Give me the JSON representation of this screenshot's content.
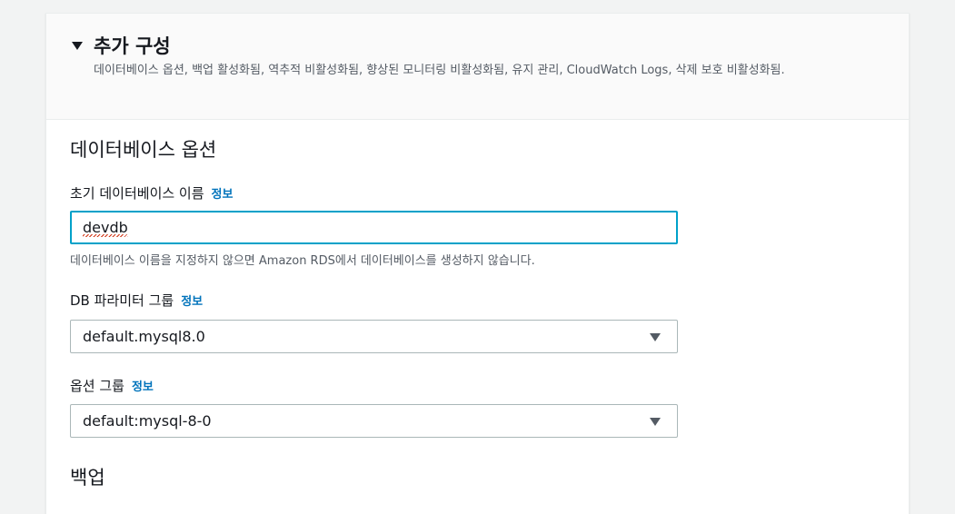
{
  "section": {
    "title": "추가 구성",
    "description": "데이터베이스 옵션, 백업 활성화됨, 역추적 비활성화됨, 향상된 모니터링 비활성화됨, 유지 관리, CloudWatch Logs, 삭제 보호 비활성화됨."
  },
  "db_options": {
    "heading": "데이터베이스 옵션",
    "initial_db_name": {
      "label": "초기 데이터베이스 이름",
      "info": "정보",
      "value": "devdb",
      "helper": "데이터베이스 이름을 지정하지 않으면 Amazon RDS에서 데이터베이스를 생성하지 않습니다."
    },
    "parameter_group": {
      "label": "DB 파라미터 그룹",
      "info": "정보",
      "value": "default.mysql8.0"
    },
    "option_group": {
      "label": "옵션 그룹",
      "info": "정보",
      "value": "default:mysql-8-0"
    }
  },
  "backup": {
    "heading": "백업"
  },
  "colors": {
    "link": "#0073bb",
    "focus": "#00a1c9",
    "background": "#f2f3f3"
  },
  "icons": {
    "expand": "caret-down-icon",
    "select": "caret-down-icon"
  }
}
